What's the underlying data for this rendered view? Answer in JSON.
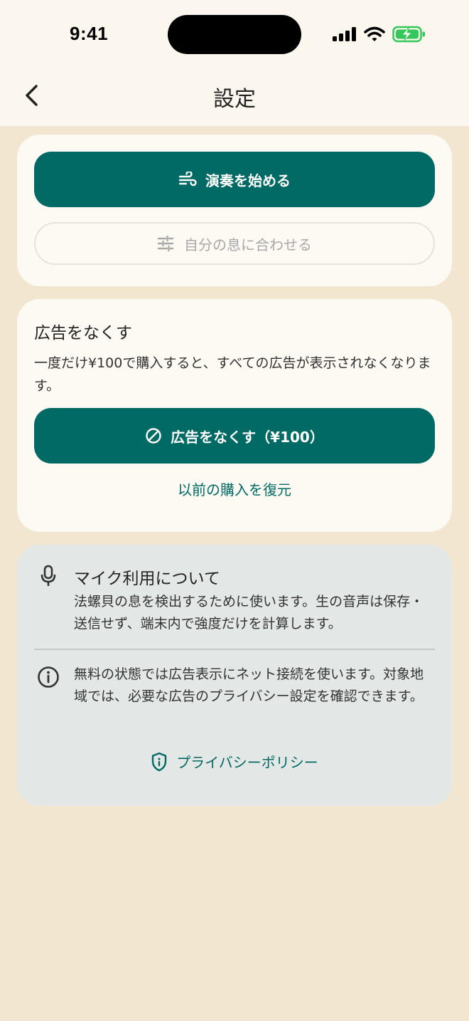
{
  "status_bar": {
    "time": "9:41"
  },
  "nav": {
    "title": "設定"
  },
  "play_card": {
    "start_label": "演奏を始める",
    "calibrate_label": "自分の息に合わせる"
  },
  "ads_card": {
    "title": "広告をなくす",
    "description": "一度だけ¥100で購入すると、すべての広告が表示されなくなります。",
    "remove_ads_label": "広告をなくす（¥100）",
    "restore_label": "以前の購入を復元"
  },
  "info_card": {
    "mic_title": "マイク利用について",
    "mic_text": "法螺貝の息を検出するために使います。生の音声は保存・送信せず、端末内で強度だけを計算します。",
    "network_text": "無料の状態では広告表示にネット接続を使います。対象地域では、必要な広告のプライバシー設定を確認できます。",
    "privacy_label": "プライバシーポリシー"
  },
  "colors": {
    "accent": "#016A64",
    "background": "#F2E6D0",
    "card": "#FDF9F3",
    "info_card": "#E3E8E6",
    "battery": "#34C759"
  },
  "icons": {
    "start": "wind-icon",
    "calibrate": "sliders-icon",
    "remove_ads": "block-icon",
    "mic": "microphone-icon",
    "network": "info-icon",
    "privacy": "shield-icon"
  }
}
